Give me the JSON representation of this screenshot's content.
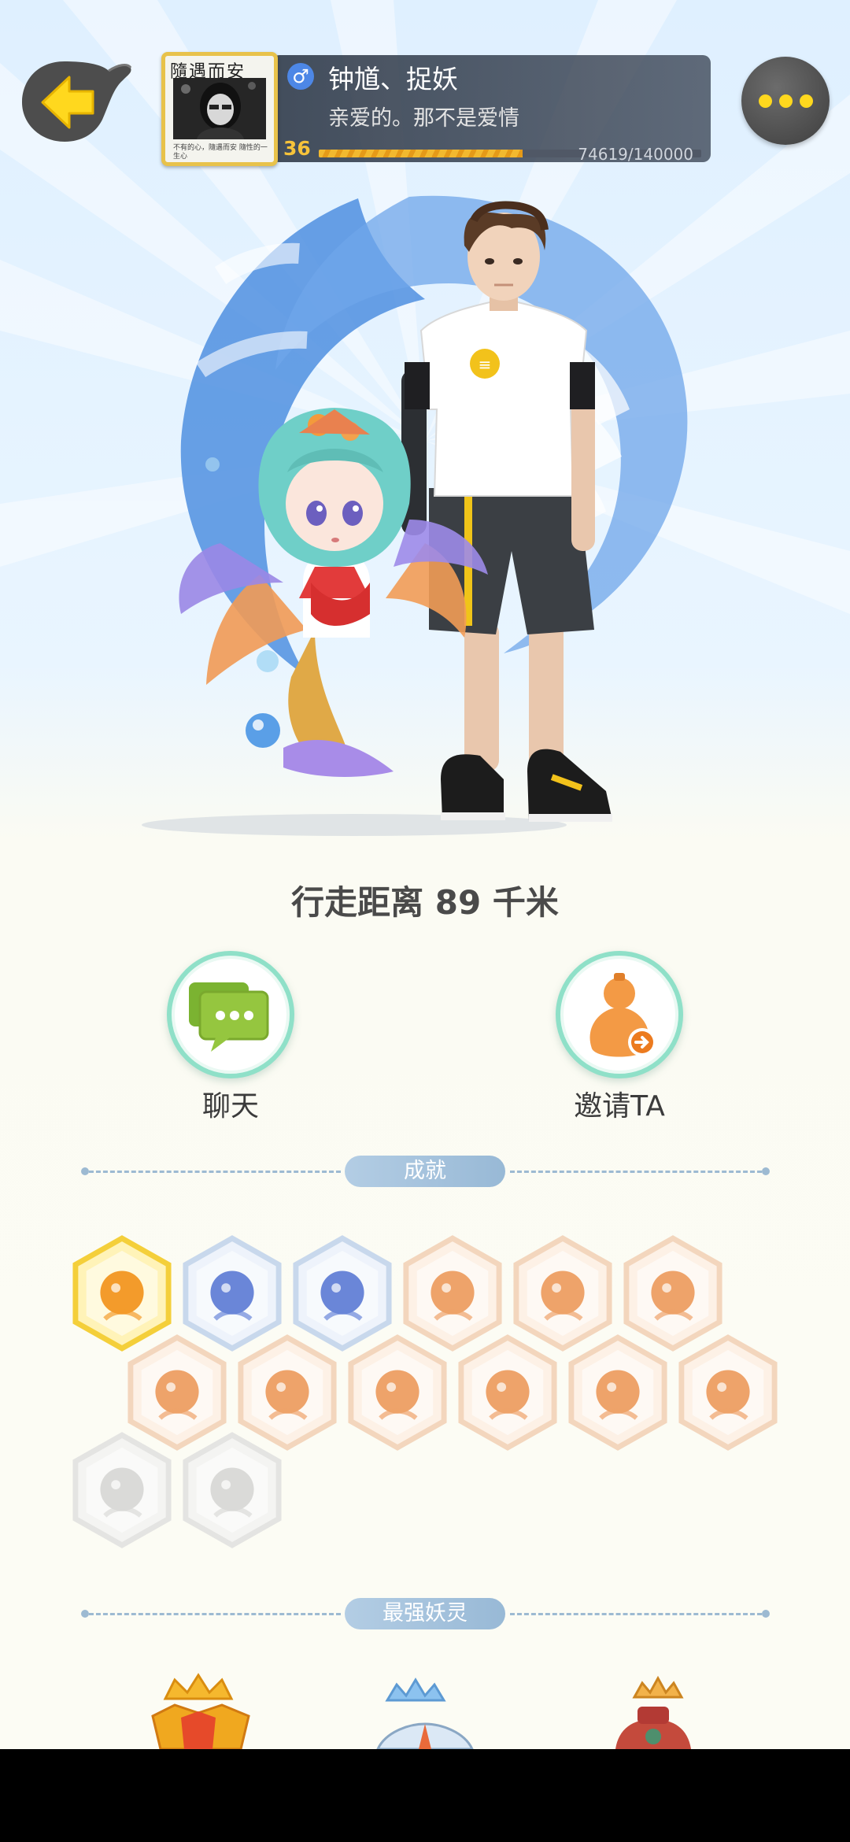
{
  "header": {
    "nickname": "钟馗、捉妖",
    "signature": "亲爱的。那不是爱情",
    "gender_symbol": "♂",
    "level": "36",
    "exp_text": "74619/140000",
    "exp_fraction": 0.533,
    "avatar_ink_text": "隨遇而安",
    "avatar_caption": "不有的心，隨遇而安 隨性的一生心"
  },
  "distance_text": "行走距离 89 千米",
  "actions": {
    "chat_label": "聊天",
    "invite_label": "邀请TA"
  },
  "sections": {
    "achievements_title": "成就",
    "strongest_title": "最强妖灵"
  },
  "colors": {
    "accent_yellow": "#ffd81e",
    "exp_orange": "#f2b92f",
    "chat_green": "#8fbf3c",
    "invite_orange": "#f39a45",
    "divider_blue": "#9dbad2"
  }
}
